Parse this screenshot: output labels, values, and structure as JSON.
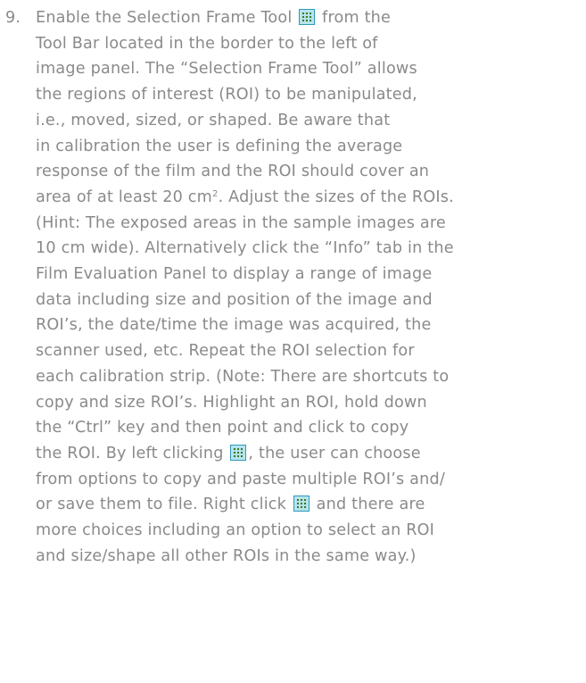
{
  "step": {
    "number": "9.",
    "tool_icon": "selection-frame-icon",
    "lines": {
      "l1a": "Enable the Selection Frame Tool",
      "l1b": "from the",
      "l2": "Tool Bar located in the border to the left of",
      "l3": "image panel. The “Selection Frame Tool” allows",
      "l4": "the regions of interest (ROI) to be manipulated,",
      "l5": "i.e., moved, sized, or shaped. Be aware that",
      "l6": "in calibration the user is defining the average",
      "l7": "response of the film and the ROI should cover an",
      "l8a": "area of at least 20 cm",
      "l8sup": "2",
      "l8b": ". Adjust the sizes of the ROIs.",
      "l9": "(Hint: The exposed areas in the sample images are",
      "l10": "10 cm wide). Alternatively click the “Info” tab in the",
      "l11": "Film Evaluation Panel to display a range of image",
      "l12": "data including size and position of the image and",
      "l13": "ROI’s, the date/time the image was acquired, the",
      "l14": "scanner used, etc. Repeat the ROI selection for",
      "l15": "each calibration strip. (Note: There are shortcuts to",
      "l16": "copy and size ROI’s. Highlight an ROI, hold down",
      "l17": "the “Ctrl” key and then point and click to copy",
      "l18a": "the ROI. By left clicking",
      "l18b": ", the user can choose",
      "l19": "from options to copy and paste multiple ROI’s and/",
      "l20": "or save them to file. Right click",
      "l20b": "and there are",
      "l21": "more choices including an option to select an ROI",
      "l22": "and size/shape all other ROIs in the same way.)"
    }
  }
}
